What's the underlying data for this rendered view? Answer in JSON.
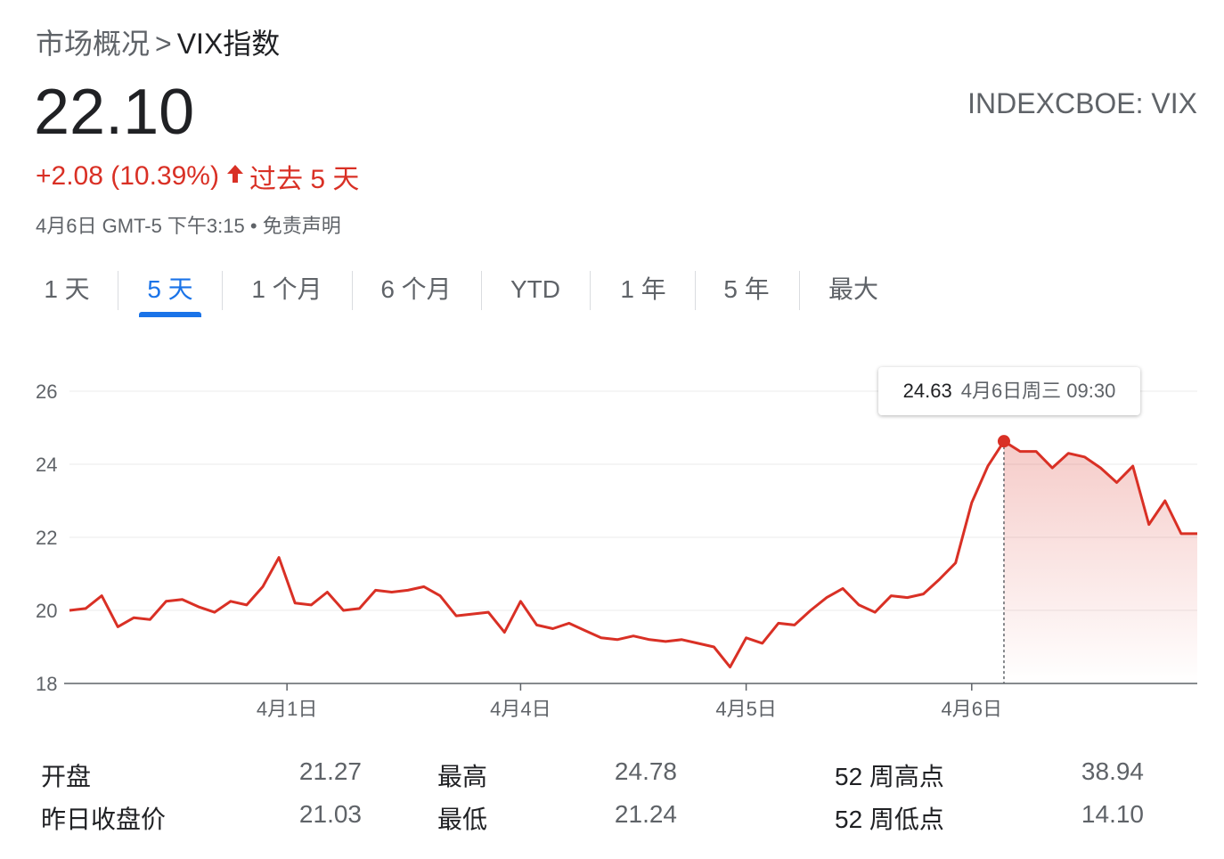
{
  "breadcrumb": {
    "parent": "市场概况",
    "separator": ">",
    "current": "VIX指数"
  },
  "quote": {
    "price": "22.10",
    "ticker": "INDEXCBOE: VIX",
    "change": "+2.08 (10.39%)",
    "period": "过去 5 天",
    "timestamp": "4月6日 GMT-5 下午3:15",
    "bullet": "•",
    "disclaimer": "免责声明"
  },
  "colors": {
    "accent": "#1a73e8",
    "negative": "#d93025",
    "muted": "#5f6368",
    "text": "#202124"
  },
  "icons": {
    "change_direction": "arrow-up-icon"
  },
  "tabs": [
    {
      "label": "1 天",
      "active": false
    },
    {
      "label": "5 天",
      "active": true
    },
    {
      "label": "1 个月",
      "active": false
    },
    {
      "label": "6 个月",
      "active": false
    },
    {
      "label": "YTD",
      "active": false
    },
    {
      "label": "1 年",
      "active": false
    },
    {
      "label": "5 年",
      "active": false
    },
    {
      "label": "最大",
      "active": false
    }
  ],
  "tooltip": {
    "value": "24.63",
    "time": "4月6日周三 09:30"
  },
  "chart_data": {
    "type": "line",
    "title": "",
    "xlabel": "",
    "ylabel": "",
    "ylim": [
      18,
      26
    ],
    "yticks": [
      "26",
      "24",
      "22",
      "20",
      "18"
    ],
    "xtick_labels": [
      "4月1日",
      "4月4日",
      "4月5日",
      "4月6日"
    ],
    "xtick_positions": [
      13.5,
      28,
      42,
      56
    ],
    "xlim": [
      0,
      70
    ],
    "grid": true,
    "highlight_index": 58,
    "series": [
      {
        "x": [
          0,
          1,
          2,
          3,
          4,
          5,
          6,
          7,
          8,
          9,
          10,
          11,
          12,
          13,
          14,
          15,
          16,
          17,
          18,
          19,
          20,
          21,
          22,
          23,
          24,
          25,
          26,
          27,
          28,
          29,
          30,
          31,
          32,
          33,
          34,
          35,
          36,
          37,
          38,
          39,
          40,
          41,
          42,
          43,
          44,
          45,
          46,
          47,
          48,
          49,
          50,
          51,
          52,
          53,
          54,
          55,
          56,
          57,
          58,
          59,
          60,
          61,
          62,
          63,
          64,
          65,
          66,
          67,
          68,
          69,
          70
        ],
        "values": [
          20.0,
          20.05,
          20.4,
          19.55,
          19.8,
          19.75,
          20.25,
          20.3,
          20.1,
          19.95,
          20.25,
          20.15,
          20.65,
          21.45,
          20.2,
          20.15,
          20.5,
          20.0,
          20.05,
          20.55,
          20.5,
          20.55,
          20.65,
          20.4,
          19.85,
          19.9,
          19.95,
          19.4,
          20.25,
          19.6,
          19.5,
          19.65,
          19.45,
          19.25,
          19.2,
          19.3,
          19.2,
          19.15,
          19.2,
          19.1,
          19.0,
          18.45,
          19.25,
          19.1,
          19.65,
          19.6,
          20.0,
          20.35,
          20.6,
          20.15,
          19.95,
          20.4,
          20.35,
          20.45,
          20.85,
          21.3,
          22.95,
          23.95,
          24.63,
          24.35,
          24.35,
          23.9,
          24.3,
          24.2,
          23.9,
          23.5,
          23.95,
          22.35,
          23.0,
          22.1,
          22.1
        ]
      }
    ]
  },
  "stats": [
    {
      "label": "开盘",
      "value": "21.27"
    },
    {
      "label": "最高",
      "value": "24.78"
    },
    {
      "label": "52 周高点",
      "value": "38.94"
    },
    {
      "label": "昨日收盘价",
      "value": "21.03"
    },
    {
      "label": "最低",
      "value": "21.24"
    },
    {
      "label": "52 周低点",
      "value": "14.10"
    }
  ]
}
